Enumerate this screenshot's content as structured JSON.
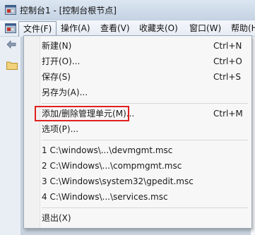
{
  "window": {
    "title": "控制台1 - [控制台根节点]"
  },
  "menubar": {
    "items": [
      {
        "label": "文件(F)"
      },
      {
        "label": "操作(A)"
      },
      {
        "label": "查看(V)"
      },
      {
        "label": "收藏夹(O)"
      },
      {
        "label": "窗口(W)"
      },
      {
        "label": "帮助(H"
      }
    ]
  },
  "file_menu": {
    "new": {
      "label": "新建(N)",
      "shortcut": "Ctrl+N"
    },
    "open": {
      "label": "打开(O)...",
      "shortcut": "Ctrl+O"
    },
    "save": {
      "label": "保存(S)",
      "shortcut": "Ctrl+S"
    },
    "save_as": {
      "label": "另存为(A)..."
    },
    "add_remove_snapin": {
      "label": "添加/删除管理单元(M)...",
      "shortcut": "Ctrl+M"
    },
    "options": {
      "label": "选项(P)..."
    },
    "recent": [
      {
        "label": "1 C:\\windows\\...\\devmgmt.msc"
      },
      {
        "label": "2 C:\\Windows\\...\\compmgmt.msc"
      },
      {
        "label": "3 C:\\Windows\\system32\\gpedit.msc"
      },
      {
        "label": "4 C:\\Windows\\...\\services.msc"
      }
    ],
    "exit": {
      "label": "退出(X)"
    }
  },
  "icons": [
    "mmc-app-icon",
    "back-arrow-icon",
    "folder-icon"
  ],
  "colors": {
    "highlight_border": "#e0211f",
    "menu_bg": "#f7f7f7"
  }
}
